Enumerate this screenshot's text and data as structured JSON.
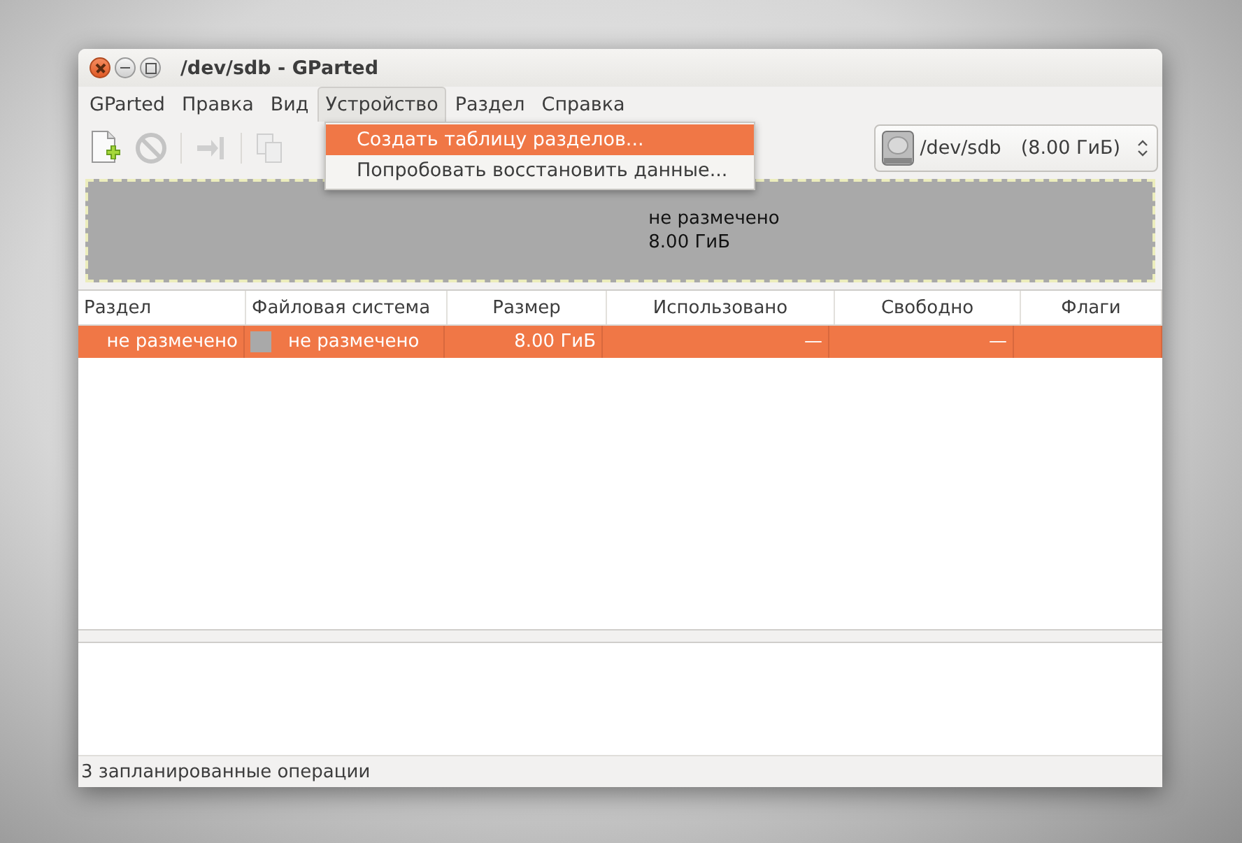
{
  "window": {
    "title": "/dev/sdb - GParted"
  },
  "menus": [
    {
      "label": "GParted",
      "selected": false
    },
    {
      "label": "Правка",
      "selected": false
    },
    {
      "label": "Вид",
      "selected": false
    },
    {
      "label": "Устройство",
      "selected": true
    },
    {
      "label": "Раздел",
      "selected": false
    },
    {
      "label": "Справка",
      "selected": false
    }
  ],
  "dropdown": [
    {
      "label": "Создать таблицу разделов...",
      "selected": true
    },
    {
      "label": "Попробовать восстановить данные...",
      "selected": false
    }
  ],
  "device_selector": {
    "device": "/dev/sdb",
    "size": "(8.00 ГиБ)"
  },
  "disk_map": {
    "label": "не размечено",
    "size": "8.00 ГиБ"
  },
  "table": {
    "columns": [
      "Раздел",
      "Файловая система",
      "Размер",
      "Использовано",
      "Свободно",
      "Флаги"
    ],
    "rows": [
      {
        "partition": "не размечено",
        "filesystem": "не размечено",
        "size": "8.00 ГиБ",
        "used": "—",
        "free": "—",
        "selected": true
      }
    ]
  },
  "status_bar": "3 запланированные операции"
}
